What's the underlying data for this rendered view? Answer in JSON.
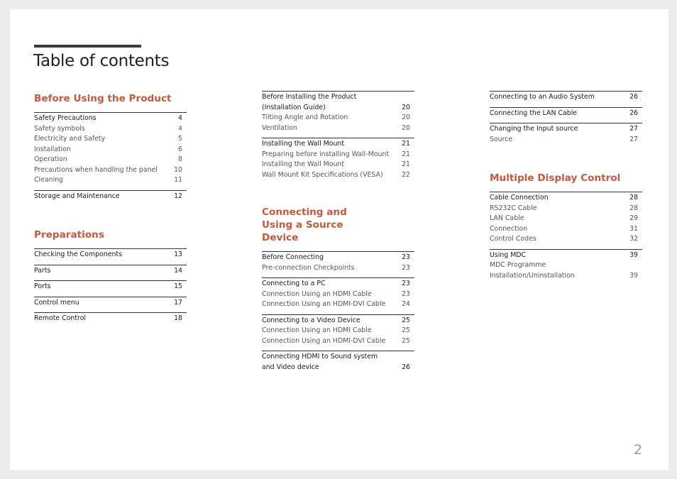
{
  "page_title": "Table of contents",
  "page_number": "2",
  "accent_color": "#c8583a",
  "columns": [
    {
      "sections": [
        {
          "title": "Before Using the Product",
          "groups": [
            {
              "items": [
                {
                  "label": "Safety Precautions",
                  "page": "4",
                  "main": true
                },
                {
                  "label": "Safety symbols",
                  "page": "4"
                },
                {
                  "label": "Electricity and Safety",
                  "page": "5"
                },
                {
                  "label": "Installation",
                  "page": "6"
                },
                {
                  "label": "Operation",
                  "page": "8"
                },
                {
                  "label": "Precautions when handling the panel",
                  "page": "10"
                },
                {
                  "label": "Cleaning",
                  "page": "11"
                }
              ]
            },
            {
              "items": [
                {
                  "label": "Storage and Maintenance",
                  "page": "12",
                  "main": true
                }
              ]
            }
          ]
        },
        {
          "title": "Preparations",
          "groups": [
            {
              "items": [
                {
                  "label": "Checking the Components",
                  "page": "13",
                  "main": true
                }
              ]
            },
            {
              "items": [
                {
                  "label": "Parts",
                  "page": "14",
                  "main": true
                }
              ]
            },
            {
              "items": [
                {
                  "label": "Ports",
                  "page": "15",
                  "main": true
                }
              ]
            },
            {
              "items": [
                {
                  "label": "Control menu",
                  "page": "17",
                  "main": true
                }
              ]
            },
            {
              "items": [
                {
                  "label": "Remote Control",
                  "page": "18",
                  "main": true
                }
              ]
            }
          ]
        }
      ]
    },
    {
      "sections": [
        {
          "title": "",
          "groups": [
            {
              "items": [
                {
                  "label": "Before Installing the Product (Installation Guide)",
                  "page": "20",
                  "main": true
                },
                {
                  "label": "Tilting Angle and Rotation",
                  "page": "20"
                },
                {
                  "label": "Ventilation",
                  "page": "20"
                }
              ]
            },
            {
              "items": [
                {
                  "label": "Installing the Wall Mount",
                  "page": "21",
                  "main": true
                },
                {
                  "label": "Preparing before installing Wall-Mount",
                  "page": "21"
                },
                {
                  "label": "Installing the Wall Mount",
                  "page": "21"
                },
                {
                  "label": "Wall Mount Kit Specifications (VESA)",
                  "page": "22"
                }
              ]
            }
          ]
        },
        {
          "title": "Connecting and Using a Source Device",
          "groups": [
            {
              "items": [
                {
                  "label": "Before Connecting",
                  "page": "23",
                  "main": true
                },
                {
                  "label": "Pre-connection Checkpoints",
                  "page": "23"
                }
              ]
            },
            {
              "items": [
                {
                  "label": "Connecting to a PC",
                  "page": "23",
                  "main": true
                },
                {
                  "label": "Connection Using an HDMI Cable",
                  "page": "23"
                },
                {
                  "label": "Connection Using an HDMI-DVI Cable",
                  "page": "24"
                }
              ]
            },
            {
              "items": [
                {
                  "label": "Connecting to a Video Device",
                  "page": "25",
                  "main": true
                },
                {
                  "label": "Connection Using an HDMI Cable",
                  "page": "25"
                },
                {
                  "label": "Connection Using an HDMI-DVI Cable",
                  "page": "25"
                }
              ]
            },
            {
              "items": [
                {
                  "label": "Connecting HDMI to Sound system and Video device",
                  "page": "26",
                  "main": true
                }
              ]
            }
          ]
        }
      ]
    },
    {
      "sections": [
        {
          "title": "",
          "groups": [
            {
              "items": [
                {
                  "label": "Connecting to an Audio System",
                  "page": "26",
                  "main": true
                }
              ]
            },
            {
              "items": [
                {
                  "label": "Connecting the LAN Cable",
                  "page": "26",
                  "main": true
                }
              ]
            },
            {
              "items": [
                {
                  "label": "Changing the Input source",
                  "page": "27",
                  "main": true
                },
                {
                  "label": "Source",
                  "page": "27"
                }
              ]
            }
          ]
        },
        {
          "title": "Multiple Display Control",
          "groups": [
            {
              "items": [
                {
                  "label": "Cable Connection",
                  "page": "28",
                  "main": true
                },
                {
                  "label": "RS232C Cable",
                  "page": "28"
                },
                {
                  "label": "LAN Cable",
                  "page": "29"
                },
                {
                  "label": "Connection",
                  "page": "31"
                },
                {
                  "label": "Control Codes",
                  "page": "32"
                }
              ]
            },
            {
              "items": [
                {
                  "label": "Using MDC",
                  "page": "39",
                  "main": true
                },
                {
                  "label": "MDC Programme Installation/Uninstallation",
                  "page": "39"
                }
              ]
            }
          ]
        }
      ]
    }
  ]
}
